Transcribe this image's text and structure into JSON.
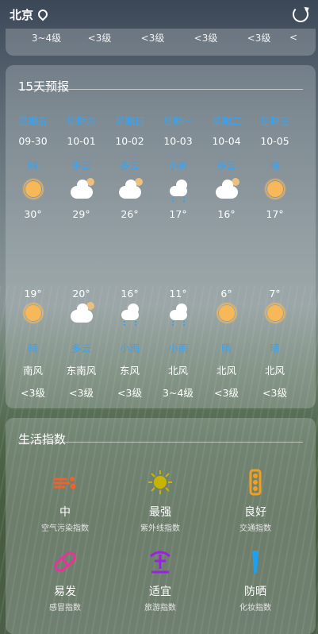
{
  "header": {
    "city": "北京"
  },
  "top_strip": [
    "3~4级",
    "<3级",
    "<3级",
    "<3级",
    "<3级",
    "<"
  ],
  "forecast": {
    "title": "15天预报",
    "days": [
      {
        "weekday": "星期五",
        "date": "09-30",
        "cond_day": "晴",
        "icon_day": "sun-icon",
        "high": "30°",
        "low": "19°",
        "icon_night": "sun-icon",
        "cond_night": "晴",
        "wind_dir": "南风",
        "wind_level": "<3级"
      },
      {
        "weekday": "星期六",
        "date": "10-01",
        "cond_day": "多云",
        "icon_day": "partly-cloudy-icon",
        "high": "29°",
        "low": "20°",
        "icon_night": "partly-cloudy-icon",
        "cond_night": "多云",
        "wind_dir": "东南风",
        "wind_level": "<3级"
      },
      {
        "weekday": "星期日",
        "date": "10-02",
        "cond_day": "多云",
        "icon_day": "partly-cloudy-icon",
        "high": "26°",
        "low": "16°",
        "icon_night": "rain-icon",
        "cond_night": "小雨",
        "wind_dir": "东风",
        "wind_level": "<3级"
      },
      {
        "weekday": "星期一",
        "date": "10-03",
        "cond_day": "小雨",
        "icon_day": "rain-icon",
        "high": "17°",
        "low": "11°",
        "icon_night": "rain-icon",
        "cond_night": "小雨",
        "wind_dir": "北风",
        "wind_level": "3~4级"
      },
      {
        "weekday": "星期二",
        "date": "10-04",
        "cond_day": "多云",
        "icon_day": "partly-cloudy-icon",
        "high": "16°",
        "low": "6°",
        "icon_night": "sun-icon",
        "cond_night": "晴",
        "wind_dir": "北风",
        "wind_level": "<3级"
      },
      {
        "weekday": "星期三",
        "date": "10-05",
        "cond_day": "晴",
        "icon_day": "sun-icon",
        "high": "17°",
        "low": "7°",
        "icon_night": "sun-icon",
        "cond_night": "晴",
        "wind_dir": "北风",
        "wind_level": "<3级"
      }
    ]
  },
  "life": {
    "title": "生活指数",
    "items": [
      {
        "value": "中",
        "label": "空气污染指数",
        "icon": "air-pollution-icon",
        "color": "#f0612d"
      },
      {
        "value": "最强",
        "label": "紫外线指数",
        "icon": "uv-sun-icon",
        "color": "#c8b400"
      },
      {
        "value": "良好",
        "label": "交通指数",
        "icon": "traffic-light-icon",
        "color": "#f0a020"
      },
      {
        "value": "易发",
        "label": "感冒指数",
        "icon": "pill-icon",
        "color": "#e6349a"
      },
      {
        "value": "适宜",
        "label": "旅游指数",
        "icon": "palm-tree-icon",
        "color": "#9b20e0"
      },
      {
        "value": "防晒",
        "label": "化妆指数",
        "icon": "cosmetic-icon",
        "color": "#1ea0f0"
      }
    ]
  }
}
